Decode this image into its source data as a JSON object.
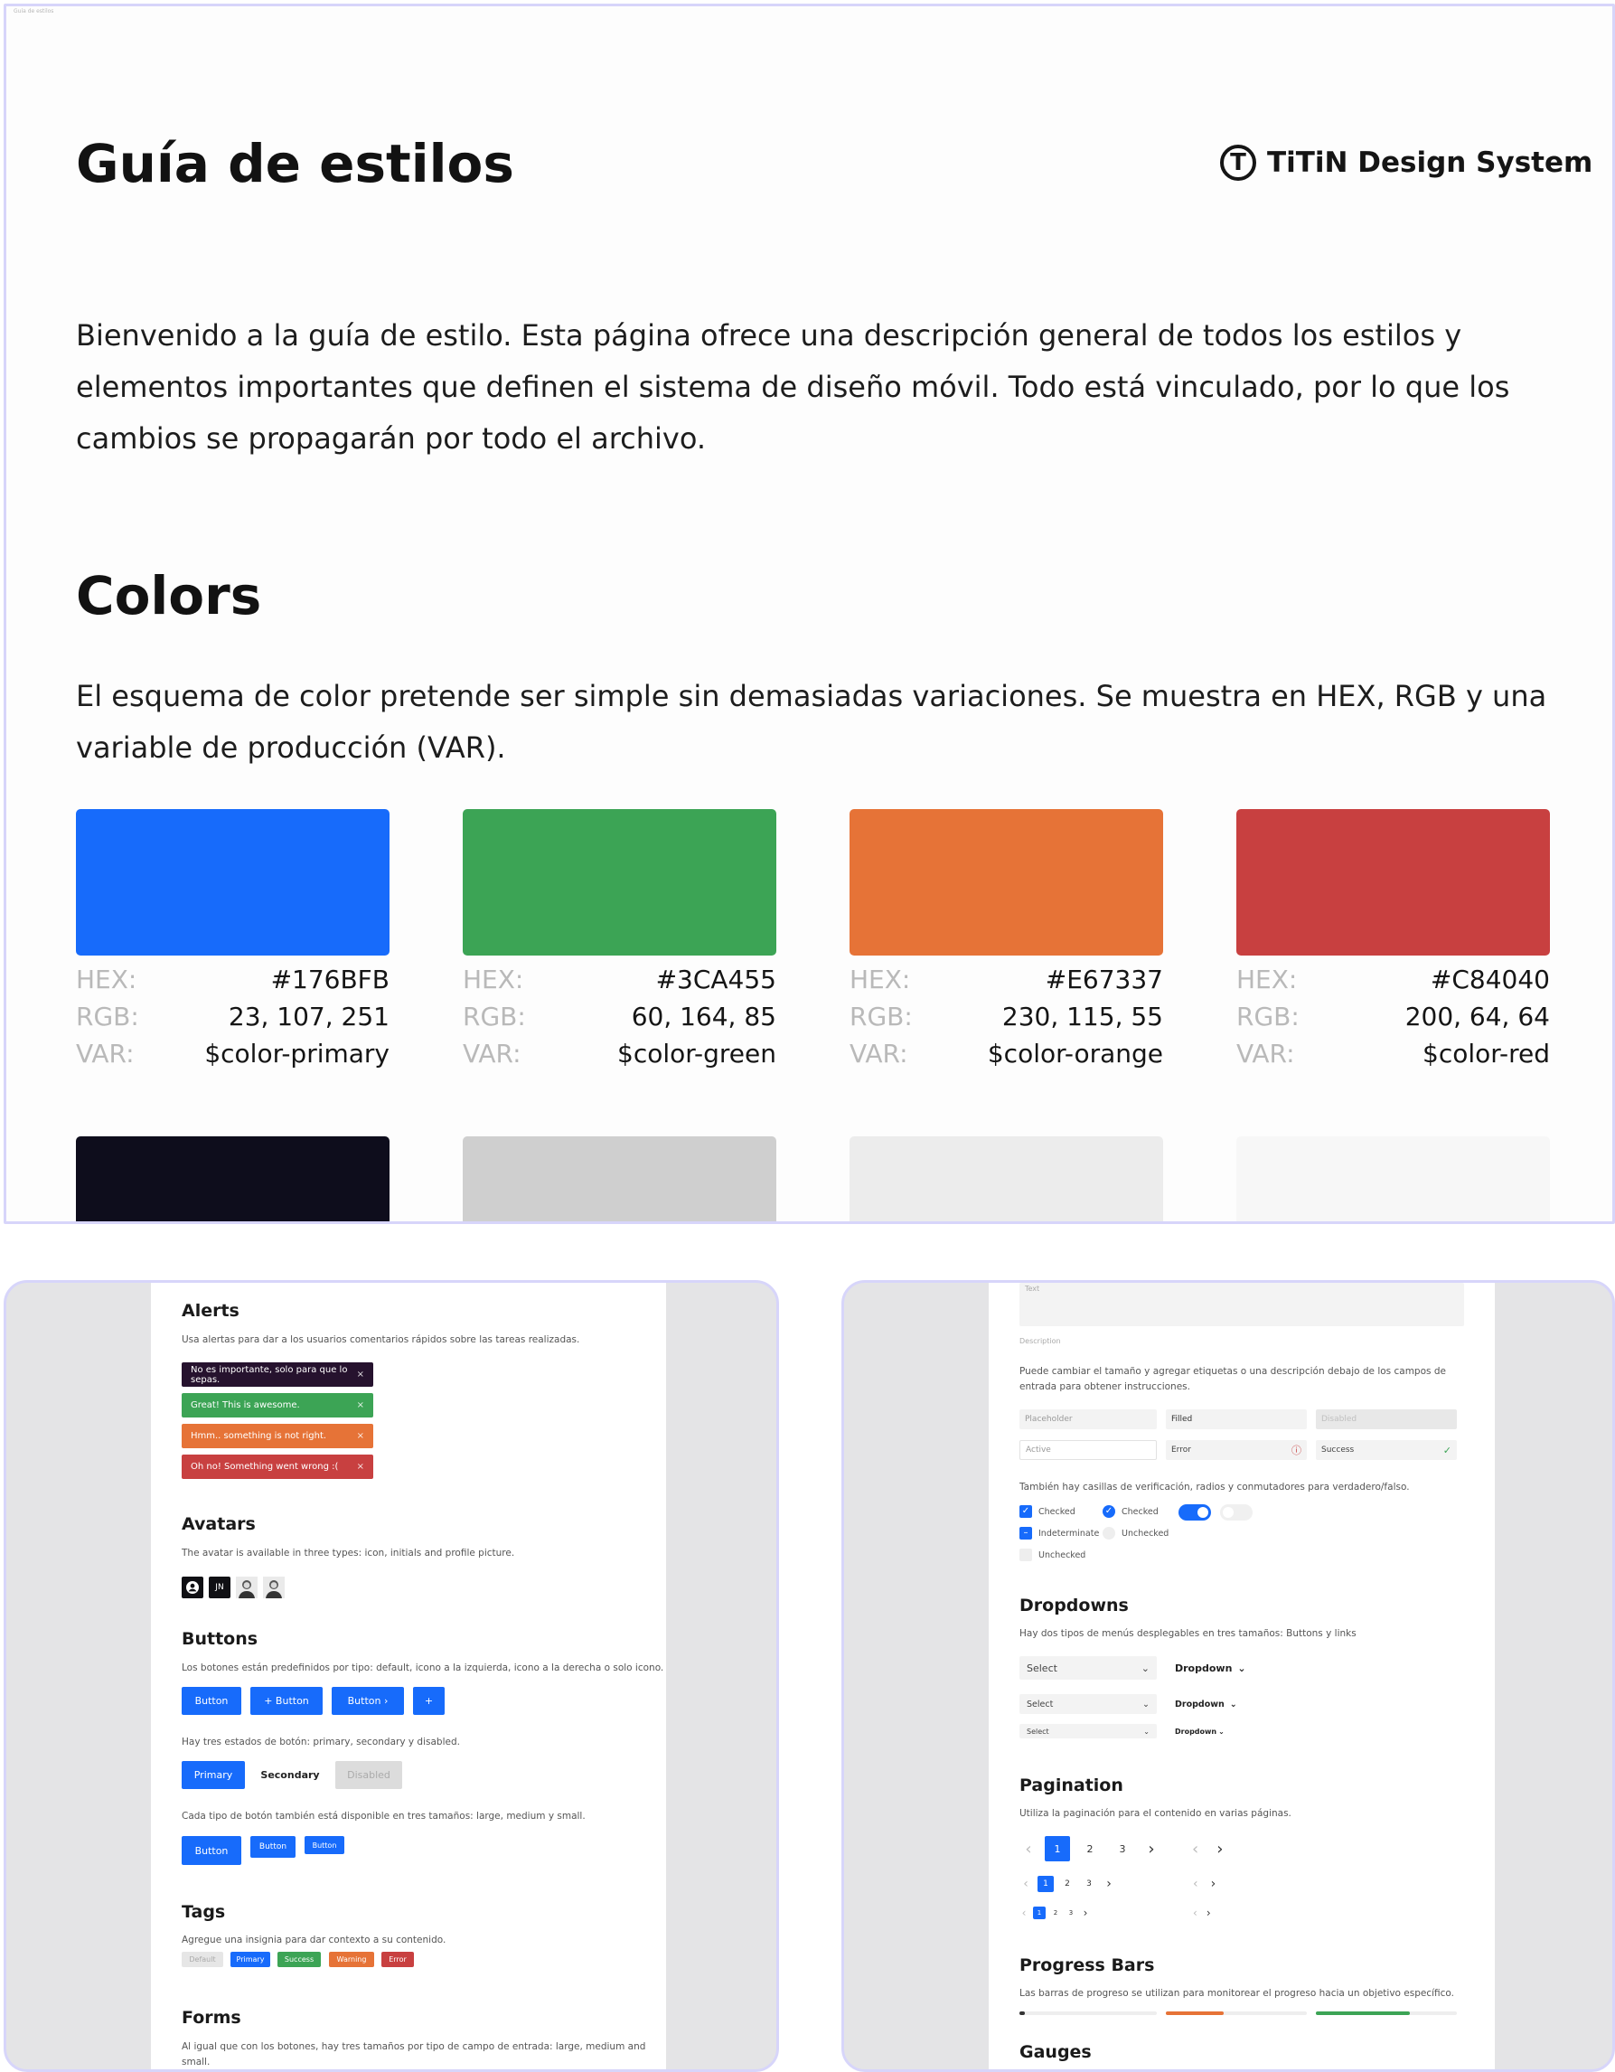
{
  "window": {
    "title": "Guía de estilos"
  },
  "header": {
    "title": "Guía de estilos",
    "logo_mark": "T",
    "logo_text": "TiTiN Design System"
  },
  "intro": "Bienvenido a la guía de estilo. Esta página ofrece una descripción general de todos los estilos y elementos importantes que definen el sistema de diseño móvil. Todo está vinculado, por lo que los cambios se propagarán por todo el archivo.",
  "colors": {
    "title": "Colors",
    "description": "El esquema de color pretende ser simple sin demasiadas variaciones. Se muestra en HEX, RGB y una variable de producción (VAR).",
    "labels": {
      "hex": "HEX:",
      "rgb": "RGB:",
      "var": "VAR:"
    },
    "items": [
      {
        "hex": "#176BFB",
        "rgb": "23, 107, 251",
        "var": "$color-primary",
        "color": "#176bfb"
      },
      {
        "hex": "#3CA455",
        "rgb": "60, 164, 85",
        "var": "$color-green",
        "color": "#3ca455"
      },
      {
        "hex": "#E67337",
        "rgb": "230, 115, 55",
        "var": "$color-orange",
        "color": "#e67337"
      },
      {
        "hex": "#C84040",
        "rgb": "200, 64, 64",
        "var": "$color-red",
        "color": "#c84040"
      }
    ],
    "second_row_colors": [
      "#0e0d1c",
      "#cfcfcf",
      "#ececec",
      "#f7f7f7"
    ]
  },
  "left": {
    "alerts": {
      "title": "Alerts",
      "description": "Usa alertas para dar a los usuarios comentarios rápidos sobre las tareas realizadas.",
      "items": [
        {
          "text": "No es importante, solo para que lo sepas.",
          "color": "#26122e",
          "close": "×"
        },
        {
          "text": "Great! This is awesome.",
          "color": "#3ca455",
          "close": "×"
        },
        {
          "text": "Hmm.. something is not right.",
          "color": "#e67337",
          "close": "×"
        },
        {
          "text": "Oh no! Something went wrong :(",
          "color": "#c84040",
          "close": "×"
        }
      ]
    },
    "avatars": {
      "title": "Avatars",
      "description": "The avatar is available in three types: icon, initials and profile picture.",
      "initials": "JN"
    },
    "buttons": {
      "title": "Buttons",
      "description": "Los botones están predefinidos por tipo: default, icono a la izquierda, icono a la derecha o solo icono.",
      "types": [
        "Button",
        "+ Button",
        "Button ›",
        "+"
      ],
      "states_description": "Hay tres estados de botón: primary, secondary y disabled.",
      "states": [
        "Primary",
        "Secondary",
        "Disabled"
      ],
      "sizes_description": "Cada tipo de botón también está disponible en tres tamaños: large, medium y small.",
      "sizes": [
        "Button",
        "Button",
        "Button"
      ]
    },
    "tags": {
      "title": "Tags",
      "description": "Agregue una insignia para dar contexto a su contenido.",
      "items": [
        {
          "label": "Default",
          "color": "#e6e6e6",
          "text": "#aaaaaa"
        },
        {
          "label": "Primary",
          "color": "#176bfb",
          "text": "#ffffff"
        },
        {
          "label": "Success",
          "color": "#3ca455",
          "text": "#ffffff"
        },
        {
          "label": "Warning",
          "color": "#e67337",
          "text": "#ffffff"
        },
        {
          "label": "Error",
          "color": "#c84040",
          "text": "#ffffff"
        }
      ]
    },
    "forms": {
      "title": "Forms",
      "description": "Al igual que con los botones, hay tres tamaños por tipo de campo de entrada: large, medium and small."
    }
  },
  "right": {
    "top_field_label": "Text",
    "top_field_caption": "Description",
    "forms_desc": "Puede cambiar el tamaño y agregar etiquetas o una descripción debajo de los campos de entrada para obtener instrucciones.",
    "inputs": [
      "Placeholder",
      "Filled",
      "Disabled",
      "Active",
      "Error",
      "Success"
    ],
    "checks_desc": "También hay casillas de verificación, radios y conmutadores para verdadero/falso.",
    "checks": [
      "Checked",
      "Checked",
      "Indeterminate",
      "Unchecked",
      "Unchecked"
    ],
    "dropdowns": {
      "title": "Dropdowns",
      "description": "Hay dos tipos de menús desplegables en tres tamaños: Buttons y links",
      "select": "Select",
      "link": "Dropdown"
    },
    "pagination": {
      "title": "Pagination",
      "description": "Utiliza la paginación para el contenido en varias páginas.",
      "pages": [
        "1",
        "2",
        "3"
      ],
      "prev": "‹",
      "next": "›"
    },
    "progress": {
      "title": "Progress Bars",
      "description": "Las barras de progreso se utilizan para monitorear el progreso hacia un objetivo específico."
    },
    "gauges": {
      "title": "Gauges"
    }
  }
}
